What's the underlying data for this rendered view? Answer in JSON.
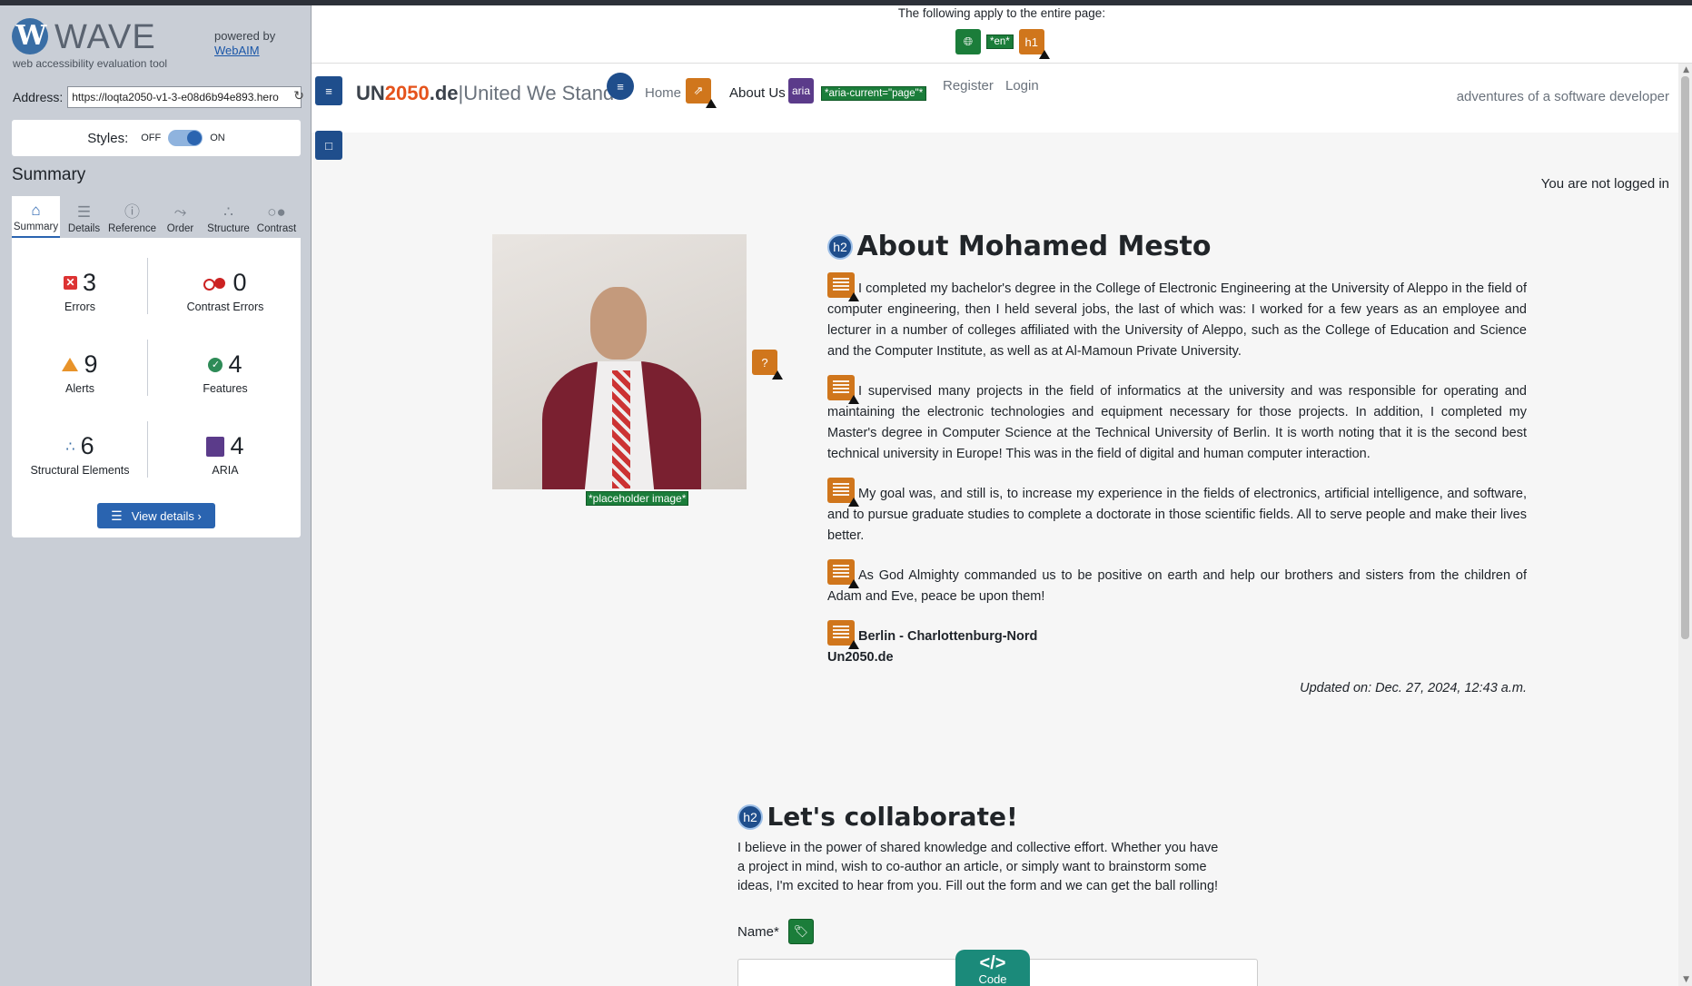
{
  "sidebar": {
    "logo_title": "WAVE",
    "logo_subtitle": "web accessibility evaluation tool",
    "powered_by": "powered by",
    "powered_link": "WebAIM",
    "address_label": "Address:",
    "address_value": "https://loqta2050-v1-3-e08d6b94e893.hero",
    "styles_label": "Styles:",
    "styles_off": "OFF",
    "styles_on": "ON",
    "summary_title": "Summary",
    "tabs": [
      {
        "label": "Summary",
        "icon": "home-icon"
      },
      {
        "label": "Details",
        "icon": "list-icon"
      },
      {
        "label": "Reference",
        "icon": "info-icon"
      },
      {
        "label": "Order",
        "icon": "order-icon"
      },
      {
        "label": "Structure",
        "icon": "structure-icon"
      },
      {
        "label": "Contrast",
        "icon": "contrast-icon"
      }
    ],
    "stats": {
      "errors": {
        "value": "3",
        "label": "Errors"
      },
      "contrast_errors": {
        "value": "0",
        "label": "Contrast Errors"
      },
      "alerts": {
        "value": "9",
        "label": "Alerts"
      },
      "features": {
        "value": "4",
        "label": "Features"
      },
      "structural": {
        "value": "6",
        "label": "Structural Elements"
      },
      "aria": {
        "value": "4",
        "label": "ARIA"
      }
    },
    "view_details": "View details ›"
  },
  "page": {
    "apply_text": "The following apply to the entire page:",
    "lang_tag": "*en*",
    "h1_badge": "h1",
    "brand_main": "UN",
    "brand_accent": "2050",
    "brand_tld": ".de",
    "brand_rest": "|United We Stand",
    "nav": {
      "home": "Home",
      "about": "About Us",
      "aria_badge": "aria",
      "aria_current": "*aria-current=\"page\"*",
      "register": "Register",
      "login": "Login"
    },
    "tagline": "adventures of a software developer",
    "not_logged": "You are not logged in",
    "placeholder_label": "*placeholder image*",
    "about": {
      "h2_badge": "h2",
      "title": "About Mohamed Mesto",
      "paragraphs": [
        "I completed my bachelor's degree in the College of Electronic Engineering at the University of Aleppo in the field of computer engineering, then I held several jobs, the last of which was: I worked for a few years as an employee and lecturer in a number of colleges affiliated with the University of Aleppo, such as the College of Education and Science and the Computer Institute, as well as at Al-Mamoun Private University.",
        "I supervised many projects in the field of informatics at the university and was responsible for operating and maintaining the electronic technologies and equipment necessary for those projects. In addition, I completed my Master's degree in Computer Science at the Technical University of Berlin. It is worth noting that it is the second best technical university in Europe! This was in the field of digital and human computer interaction.",
        "My goal was, and still is, to increase my experience in the fields of electronics, artificial intelligence, and software, and to pursue graduate studies to complete a doctorate in those scientific fields. All to serve people and make their lives better.",
        "As God Almighty commanded us to be positive on earth and help our brothers and sisters from the children of Adam and Eve, peace be upon them!"
      ],
      "location": "Berlin - Charlottenburg-Nord",
      "site": "Un2050.de",
      "updated": "Updated on: Dec. 27, 2024, 12:43 a.m."
    },
    "collab": {
      "h2_badge": "h2",
      "title": "Let's collaborate!",
      "text": "I believe in the power of shared knowledge and collective effort. Whether you have a project in mind, wish to co-author an article, or simply want to brainstorm some ideas, I'm excited to hear from you. Fill out the form and we can get the ball rolling!",
      "name_label": "Name*"
    },
    "code_button": {
      "symbol": "</>",
      "label": "Code"
    }
  }
}
